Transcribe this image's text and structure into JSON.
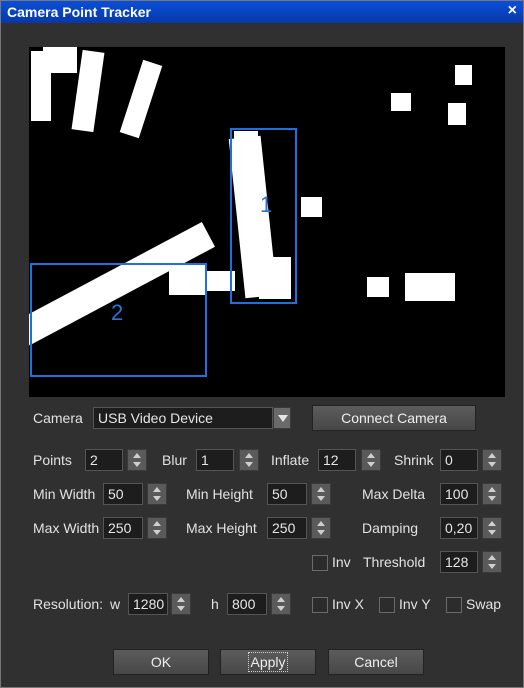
{
  "window": {
    "title": "Camera Point Tracker",
    "close_label": "×"
  },
  "preview": {
    "tracked_points": [
      {
        "id": "1"
      },
      {
        "id": "2"
      }
    ],
    "colors": {
      "background": "#000000",
      "blob": "#ffffff",
      "tracker": "#1e6fe0"
    }
  },
  "camera": {
    "label": "Camera",
    "selected": "USB Video Device",
    "connect_label": "Connect Camera"
  },
  "params": {
    "points": {
      "label": "Points",
      "value": "2"
    },
    "blur": {
      "label": "Blur",
      "value": "1"
    },
    "inflate": {
      "label": "Inflate",
      "value": "12"
    },
    "shrink": {
      "label": "Shrink",
      "value": "0"
    },
    "min_width": {
      "label": "Min Width",
      "value": "50"
    },
    "min_height": {
      "label": "Min Height",
      "value": "50"
    },
    "max_delta": {
      "label": "Max Delta",
      "value": "100"
    },
    "max_width": {
      "label": "Max Width",
      "value": "250"
    },
    "max_height": {
      "label": "Max Height",
      "value": "250"
    },
    "damping": {
      "label": "Damping",
      "value": "0,20"
    },
    "inv": {
      "label": "Inv",
      "checked": false
    },
    "threshold": {
      "label": "Threshold",
      "value": "128"
    }
  },
  "resolution": {
    "label": "Resolution:",
    "w_label": "w",
    "w_value": "1280",
    "h_label": "h",
    "h_value": "800"
  },
  "options": {
    "inv_x": "Inv X",
    "inv_y": "Inv Y",
    "swap": "Swap"
  },
  "buttons": {
    "ok": "OK",
    "apply": "Apply",
    "cancel": "Cancel"
  }
}
